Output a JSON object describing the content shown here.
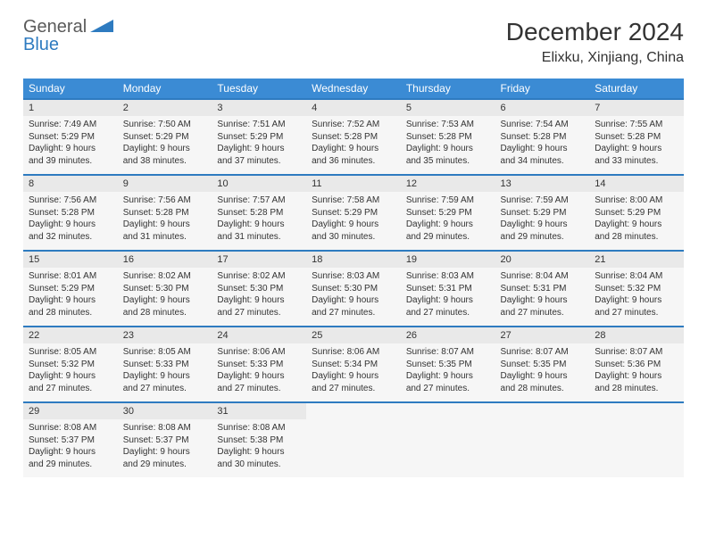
{
  "logo": {
    "part1": "General",
    "part2": "Blue"
  },
  "title": "December 2024",
  "location": "Elixku, Xinjiang, China",
  "dow": [
    "Sunday",
    "Monday",
    "Tuesday",
    "Wednesday",
    "Thursday",
    "Friday",
    "Saturday"
  ],
  "weeks": [
    {
      "dates": [
        "1",
        "2",
        "3",
        "4",
        "5",
        "6",
        "7"
      ],
      "cells": [
        {
          "sunrise": "Sunrise: 7:49 AM",
          "sunset": "Sunset: 5:29 PM",
          "day1": "Daylight: 9 hours",
          "day2": "and 39 minutes."
        },
        {
          "sunrise": "Sunrise: 7:50 AM",
          "sunset": "Sunset: 5:29 PM",
          "day1": "Daylight: 9 hours",
          "day2": "and 38 minutes."
        },
        {
          "sunrise": "Sunrise: 7:51 AM",
          "sunset": "Sunset: 5:29 PM",
          "day1": "Daylight: 9 hours",
          "day2": "and 37 minutes."
        },
        {
          "sunrise": "Sunrise: 7:52 AM",
          "sunset": "Sunset: 5:28 PM",
          "day1": "Daylight: 9 hours",
          "day2": "and 36 minutes."
        },
        {
          "sunrise": "Sunrise: 7:53 AM",
          "sunset": "Sunset: 5:28 PM",
          "day1": "Daylight: 9 hours",
          "day2": "and 35 minutes."
        },
        {
          "sunrise": "Sunrise: 7:54 AM",
          "sunset": "Sunset: 5:28 PM",
          "day1": "Daylight: 9 hours",
          "day2": "and 34 minutes."
        },
        {
          "sunrise": "Sunrise: 7:55 AM",
          "sunset": "Sunset: 5:28 PM",
          "day1": "Daylight: 9 hours",
          "day2": "and 33 minutes."
        }
      ]
    },
    {
      "dates": [
        "8",
        "9",
        "10",
        "11",
        "12",
        "13",
        "14"
      ],
      "cells": [
        {
          "sunrise": "Sunrise: 7:56 AM",
          "sunset": "Sunset: 5:28 PM",
          "day1": "Daylight: 9 hours",
          "day2": "and 32 minutes."
        },
        {
          "sunrise": "Sunrise: 7:56 AM",
          "sunset": "Sunset: 5:28 PM",
          "day1": "Daylight: 9 hours",
          "day2": "and 31 minutes."
        },
        {
          "sunrise": "Sunrise: 7:57 AM",
          "sunset": "Sunset: 5:28 PM",
          "day1": "Daylight: 9 hours",
          "day2": "and 31 minutes."
        },
        {
          "sunrise": "Sunrise: 7:58 AM",
          "sunset": "Sunset: 5:29 PM",
          "day1": "Daylight: 9 hours",
          "day2": "and 30 minutes."
        },
        {
          "sunrise": "Sunrise: 7:59 AM",
          "sunset": "Sunset: 5:29 PM",
          "day1": "Daylight: 9 hours",
          "day2": "and 29 minutes."
        },
        {
          "sunrise": "Sunrise: 7:59 AM",
          "sunset": "Sunset: 5:29 PM",
          "day1": "Daylight: 9 hours",
          "day2": "and 29 minutes."
        },
        {
          "sunrise": "Sunrise: 8:00 AM",
          "sunset": "Sunset: 5:29 PM",
          "day1": "Daylight: 9 hours",
          "day2": "and 28 minutes."
        }
      ]
    },
    {
      "dates": [
        "15",
        "16",
        "17",
        "18",
        "19",
        "20",
        "21"
      ],
      "cells": [
        {
          "sunrise": "Sunrise: 8:01 AM",
          "sunset": "Sunset: 5:29 PM",
          "day1": "Daylight: 9 hours",
          "day2": "and 28 minutes."
        },
        {
          "sunrise": "Sunrise: 8:02 AM",
          "sunset": "Sunset: 5:30 PM",
          "day1": "Daylight: 9 hours",
          "day2": "and 28 minutes."
        },
        {
          "sunrise": "Sunrise: 8:02 AM",
          "sunset": "Sunset: 5:30 PM",
          "day1": "Daylight: 9 hours",
          "day2": "and 27 minutes."
        },
        {
          "sunrise": "Sunrise: 8:03 AM",
          "sunset": "Sunset: 5:30 PM",
          "day1": "Daylight: 9 hours",
          "day2": "and 27 minutes."
        },
        {
          "sunrise": "Sunrise: 8:03 AM",
          "sunset": "Sunset: 5:31 PM",
          "day1": "Daylight: 9 hours",
          "day2": "and 27 minutes."
        },
        {
          "sunrise": "Sunrise: 8:04 AM",
          "sunset": "Sunset: 5:31 PM",
          "day1": "Daylight: 9 hours",
          "day2": "and 27 minutes."
        },
        {
          "sunrise": "Sunrise: 8:04 AM",
          "sunset": "Sunset: 5:32 PM",
          "day1": "Daylight: 9 hours",
          "day2": "and 27 minutes."
        }
      ]
    },
    {
      "dates": [
        "22",
        "23",
        "24",
        "25",
        "26",
        "27",
        "28"
      ],
      "cells": [
        {
          "sunrise": "Sunrise: 8:05 AM",
          "sunset": "Sunset: 5:32 PM",
          "day1": "Daylight: 9 hours",
          "day2": "and 27 minutes."
        },
        {
          "sunrise": "Sunrise: 8:05 AM",
          "sunset": "Sunset: 5:33 PM",
          "day1": "Daylight: 9 hours",
          "day2": "and 27 minutes."
        },
        {
          "sunrise": "Sunrise: 8:06 AM",
          "sunset": "Sunset: 5:33 PM",
          "day1": "Daylight: 9 hours",
          "day2": "and 27 minutes."
        },
        {
          "sunrise": "Sunrise: 8:06 AM",
          "sunset": "Sunset: 5:34 PM",
          "day1": "Daylight: 9 hours",
          "day2": "and 27 minutes."
        },
        {
          "sunrise": "Sunrise: 8:07 AM",
          "sunset": "Sunset: 5:35 PM",
          "day1": "Daylight: 9 hours",
          "day2": "and 27 minutes."
        },
        {
          "sunrise": "Sunrise: 8:07 AM",
          "sunset": "Sunset: 5:35 PM",
          "day1": "Daylight: 9 hours",
          "day2": "and 28 minutes."
        },
        {
          "sunrise": "Sunrise: 8:07 AM",
          "sunset": "Sunset: 5:36 PM",
          "day1": "Daylight: 9 hours",
          "day2": "and 28 minutes."
        }
      ]
    },
    {
      "dates": [
        "29",
        "30",
        "31",
        "",
        "",
        "",
        ""
      ],
      "cells": [
        {
          "sunrise": "Sunrise: 8:08 AM",
          "sunset": "Sunset: 5:37 PM",
          "day1": "Daylight: 9 hours",
          "day2": "and 29 minutes."
        },
        {
          "sunrise": "Sunrise: 8:08 AM",
          "sunset": "Sunset: 5:37 PM",
          "day1": "Daylight: 9 hours",
          "day2": "and 29 minutes."
        },
        {
          "sunrise": "Sunrise: 8:08 AM",
          "sunset": "Sunset: 5:38 PM",
          "day1": "Daylight: 9 hours",
          "day2": "and 30 minutes."
        },
        null,
        null,
        null,
        null
      ]
    }
  ]
}
